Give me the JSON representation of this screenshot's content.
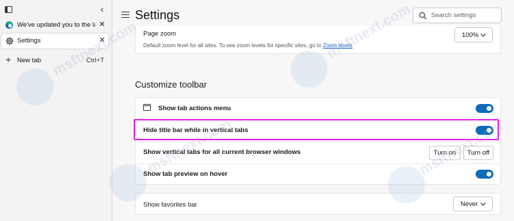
{
  "tabstrip": {
    "tabs": [
      {
        "title": "We've updated you to the latest",
        "close": "✕"
      },
      {
        "title": "Settings",
        "close": "✕"
      }
    ],
    "new_tab": {
      "label": "New tab",
      "shortcut": "Ctrl+T"
    }
  },
  "header": {
    "title": "Settings",
    "search_placeholder": "Search settings"
  },
  "page_zoom": {
    "label": "Page zoom",
    "description": "Default zoom level for all sites. To see zoom levels for specific sites, go to",
    "link": "Zoom levels",
    "value": "100%"
  },
  "customize_toolbar": {
    "title": "Customize toolbar",
    "rows": [
      {
        "label": "Show tab actions menu",
        "toggle_on": true
      },
      {
        "label": "Hide title bar while in vertical tabs",
        "toggle_on": true
      },
      {
        "label": "Show vertical tabs for all current browser windows",
        "turn_on": "Turn on",
        "turn_off": "Turn off"
      },
      {
        "label": "Show tab preview on hover",
        "toggle_on": true
      }
    ]
  },
  "favorites_bar": {
    "label": "Show favorites bar",
    "value": "Never"
  },
  "watermark": {
    "text": "msftnext.com"
  },
  "colors": {
    "accent": "#0f6cbd",
    "highlight": "#e61ee6",
    "link": "#1664c0"
  }
}
